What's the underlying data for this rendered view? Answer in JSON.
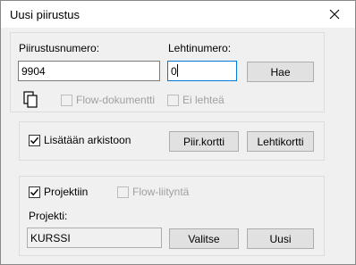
{
  "window": {
    "title": "Uusi piirustus"
  },
  "fields": {
    "piirustusnumero_label": "Piirustusnumero:",
    "piirustusnumero_value": "9904",
    "lehtinumero_label": "Lehtinumero:",
    "lehtinumero_value": "0",
    "hae_label": "Hae"
  },
  "options": {
    "flow_dokumentti": {
      "label": "Flow-dokumentti",
      "checked": false,
      "enabled": false
    },
    "ei_lehtea": {
      "label": "Ei lehteä",
      "checked": false,
      "enabled": false
    }
  },
  "archive": {
    "checkbox_label": "Lisätään arkistoon",
    "checked": true,
    "piir_kortti_label": "Piir.kortti",
    "lehtikortti_label": "Lehtikortti"
  },
  "project": {
    "projektiin_label": "Projektiin",
    "projektiin_checked": true,
    "flow_liitynta_label": "Flow-liityntä",
    "flow_liitynta_checked": false,
    "projekti_label": "Projekti:",
    "projekti_value": "KURSSI",
    "valitse_label": "Valitse",
    "uusi_label": "Uusi"
  },
  "icons": {
    "copy": "copy-icon",
    "close": "close-icon",
    "check": "checkmark-icon"
  }
}
